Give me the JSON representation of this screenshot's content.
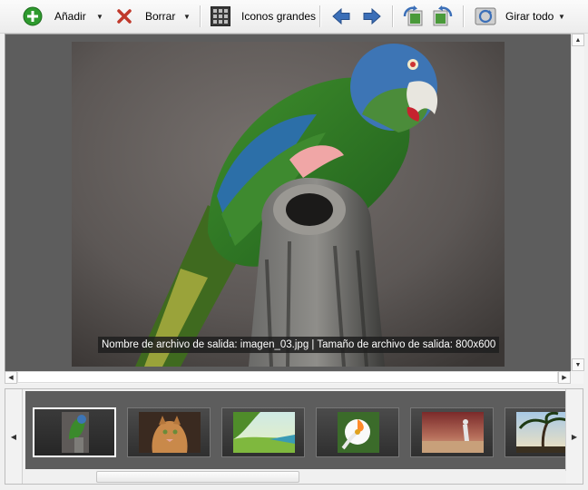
{
  "toolbar": {
    "add_label": "Añadir",
    "delete_label": "Borrar",
    "view_label": "Iconos grandes",
    "rotate_all_label": "Girar todo"
  },
  "preview": {
    "caption": "Nombre de archivo de salida: imagen_03.jpg | Tamaño de archivo de salida: 800x600"
  },
  "colors": {
    "add_green": "#2e9a2e",
    "delete_red": "#c0392b",
    "arrow_blue": "#3b6fb8",
    "rotate_green": "#4a9a3a"
  },
  "filmstrip": {
    "thumbnails": [
      {
        "name": "parrot",
        "selected": true
      },
      {
        "name": "cat",
        "selected": false
      },
      {
        "name": "tropical-beach",
        "selected": false
      },
      {
        "name": "flower",
        "selected": false
      },
      {
        "name": "desert-figure",
        "selected": false
      },
      {
        "name": "palm-tree",
        "selected": false
      }
    ]
  }
}
